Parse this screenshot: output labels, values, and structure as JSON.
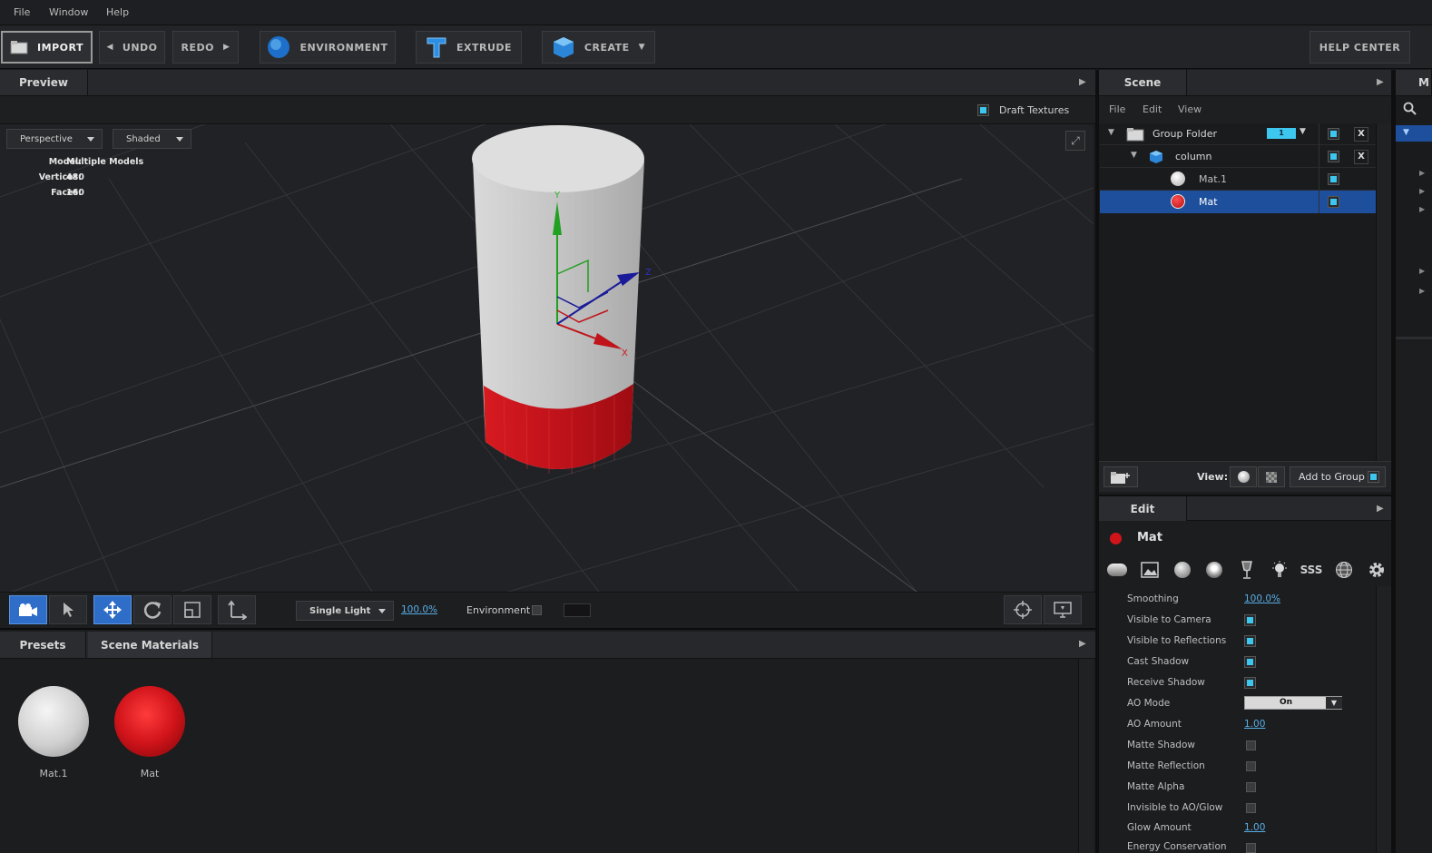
{
  "menu": {
    "file": "File",
    "window": "Window",
    "help": "Help"
  },
  "toolbar": {
    "import": "IMPORT",
    "undo": "UNDO",
    "redo": "REDO",
    "environment": "ENVIRONMENT",
    "extrude": "EXTRUDE",
    "create": "CREATE",
    "help_center": "HELP CENTER"
  },
  "preview": {
    "tab": "Preview",
    "draft_textures": "Draft Textures",
    "camera_mode": "Perspective",
    "shading_mode": "Shaded",
    "stats": {
      "model_label": "Model:",
      "model_value": "Multiple Models",
      "vertices_label": "Vertices:",
      "vertices_value": "480",
      "faces_label": "Faces:",
      "faces_value": "160"
    },
    "axes": {
      "y": "Y",
      "x": "X",
      "z": "Z"
    }
  },
  "viewport_bar": {
    "lighting": "Single Light",
    "lighting_percent": "100.0%",
    "environment_label": "Environment"
  },
  "bottom": {
    "tab_presets": "Presets",
    "tab_scene_materials": "Scene Materials",
    "materials": [
      {
        "name": "Mat.1",
        "color": "#d8d8d8"
      },
      {
        "name": "Mat",
        "color": "#d0141a"
      }
    ]
  },
  "scene": {
    "tab": "Scene",
    "menu": [
      "File",
      "Edit",
      "View"
    ],
    "tree": [
      {
        "label": "Group Folder",
        "badge": "1",
        "icon": "folder-icon"
      },
      {
        "label": "column",
        "icon": "cube-icon"
      },
      {
        "label": "Mat.1",
        "icon": "material-sphere-icon"
      },
      {
        "label": "Mat",
        "icon": "material-sphere-icon",
        "selected": true
      }
    ],
    "view_label": "View:",
    "add_to_group": "Add to Group"
  },
  "edit": {
    "tab": "Edit",
    "material_name": "Mat",
    "sss_label": "SSS",
    "props": [
      {
        "label": "Smoothing",
        "type": "link",
        "value": "100.0%"
      },
      {
        "label": "Visible to Camera",
        "type": "check",
        "checked": true
      },
      {
        "label": "Visible to Reflections",
        "type": "check",
        "checked": true
      },
      {
        "label": "Cast Shadow",
        "type": "check",
        "checked": true
      },
      {
        "label": "Receive Shadow",
        "type": "check",
        "checked": true
      },
      {
        "label": "AO Mode",
        "type": "select",
        "value": "On"
      },
      {
        "label": "AO Amount",
        "type": "link",
        "value": "1.00"
      },
      {
        "label": "Matte Shadow",
        "type": "check",
        "checked": false
      },
      {
        "label": "Matte Reflection",
        "type": "check",
        "checked": false
      },
      {
        "label": "Matte Alpha",
        "type": "check",
        "checked": false
      },
      {
        "label": "Invisible to AO/Glow",
        "type": "check",
        "checked": false
      },
      {
        "label": "Glow Amount",
        "type": "link",
        "value": "1.00"
      },
      {
        "label": "Energy Conservation",
        "type": "check",
        "checked": false
      }
    ]
  },
  "right_strip": {
    "tab": "M"
  },
  "colors": {
    "accent": "#3dc6ee",
    "selection": "#1e4f9c",
    "red_material": "#d0141a"
  }
}
